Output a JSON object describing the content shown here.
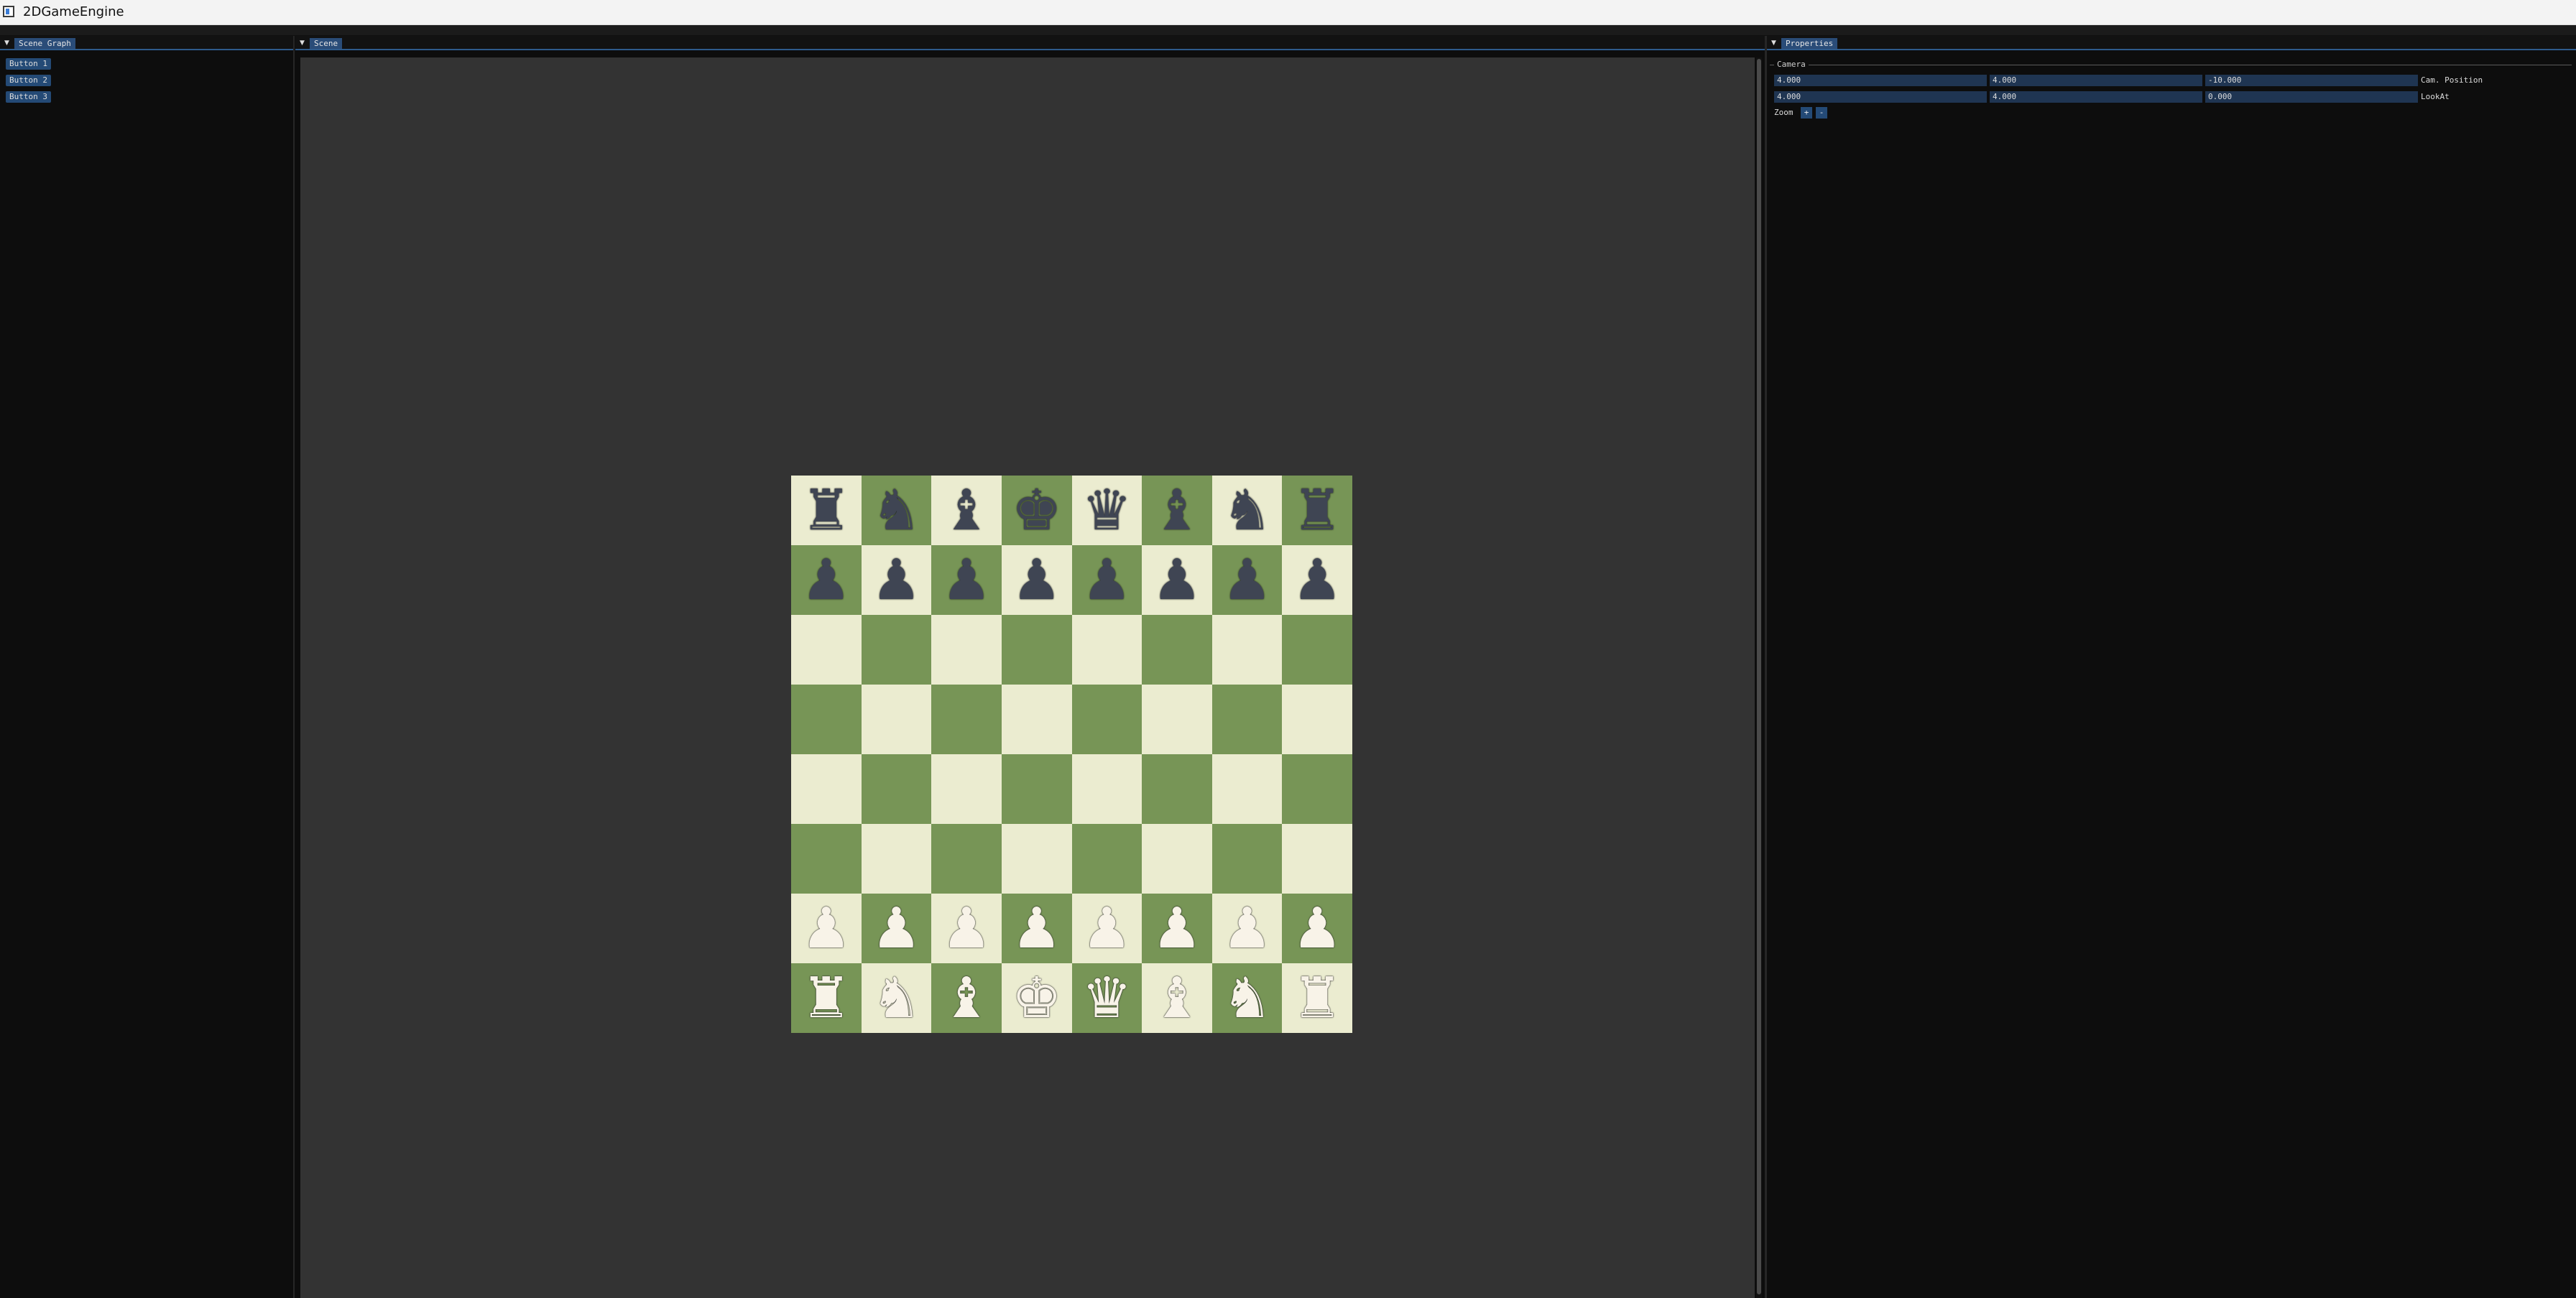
{
  "window": {
    "title": "2DGameEngine"
  },
  "scene_graph": {
    "tab_label": "Scene Graph",
    "buttons": [
      "Button 1",
      "Button 2",
      "Button 3"
    ]
  },
  "scene": {
    "tab_label": "Scene",
    "board": [
      [
        "r",
        "n",
        "b",
        "k",
        "q",
        "b",
        "n",
        "r"
      ],
      [
        "p",
        "p",
        "p",
        "p",
        "p",
        "p",
        "p",
        "p"
      ],
      [
        "",
        "",
        "",
        "",
        "",
        "",
        "",
        ""
      ],
      [
        "",
        "",
        "",
        "",
        "",
        "",
        "",
        ""
      ],
      [
        "",
        "",
        "",
        "",
        "",
        "",
        "",
        ""
      ],
      [
        "",
        "",
        "",
        "",
        "",
        "",
        "",
        ""
      ],
      [
        "P",
        "P",
        "P",
        "P",
        "P",
        "P",
        "P",
        "P"
      ],
      [
        "R",
        "N",
        "B",
        "K",
        "Q",
        "B",
        "N",
        "R"
      ]
    ],
    "colors": {
      "light_square": "#ebecd0",
      "dark_square": "#779556",
      "background": "#333333"
    }
  },
  "properties": {
    "tab_label": "Properties",
    "camera_section": "Camera",
    "cam_position": {
      "label": "Cam. Position",
      "x": "4.000",
      "y": "4.000",
      "z": "-10.000"
    },
    "look_at": {
      "label": "LookAt",
      "x": "4.000",
      "y": "4.000",
      "z": "0.000"
    },
    "zoom": {
      "label": "Zoom",
      "plus": "+",
      "minus": "-"
    }
  }
}
